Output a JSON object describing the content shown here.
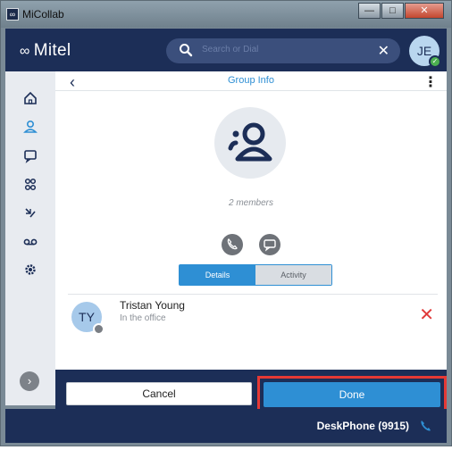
{
  "window": {
    "title": "MiCollab",
    "icon_name": "micollab-logo-icon",
    "buttons": [
      "minimize",
      "maximize",
      "close"
    ]
  },
  "header": {
    "logo_mark": "∞",
    "logo_text": "Mitel",
    "search_placeholder": "Search or Dial",
    "avatar_initials": "JE",
    "brand_color": "#1c2e57",
    "accent_color": "#2e8fd4"
  },
  "nav": {
    "items": [
      {
        "name": "home-icon"
      },
      {
        "name": "contacts-icon"
      },
      {
        "name": "chat-icon"
      },
      {
        "name": "groups-icon"
      },
      {
        "name": "call-history-icon"
      },
      {
        "name": "voicemail-icon"
      },
      {
        "name": "settings-icon"
      }
    ]
  },
  "panel": {
    "title": "Group Info",
    "members_count_label": "2 members",
    "tabs": {
      "details": "Details",
      "activity": "Activity"
    }
  },
  "members": [
    {
      "initials": "TY",
      "name": "Tristan Young",
      "status": "In the office",
      "presence_color": "#7a7e84"
    }
  ],
  "actions": {
    "cancel_label": "Cancel",
    "done_label": "Done"
  },
  "footer": {
    "deskphone_label": "DeskPhone (9915)"
  }
}
